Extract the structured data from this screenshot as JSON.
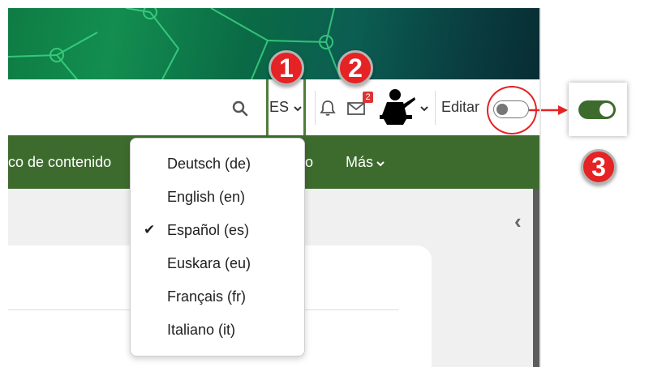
{
  "header": {
    "language_label": "ES",
    "messages_count": "2",
    "edit_label": "Editar"
  },
  "nav": {
    "item_partial": "co de contenido",
    "item_o": "o",
    "more_label": "Más"
  },
  "languages": [
    {
      "label": "Deutsch (de)",
      "selected": false
    },
    {
      "label": "English (en)",
      "selected": false
    },
    {
      "label": "Español (es)",
      "selected": true
    },
    {
      "label": "Euskara (eu)",
      "selected": false
    },
    {
      "label": "Français (fr)",
      "selected": false
    },
    {
      "label": "Italiano (it)",
      "selected": false
    }
  ],
  "callouts": {
    "one": "1",
    "two": "2",
    "three": "3"
  },
  "icons": {
    "check": "✔",
    "collapse": "‹"
  },
  "colors": {
    "nav_green": "#3d6b2e",
    "toggle_on": "#3d6b2e",
    "callout_red": "#e52224"
  }
}
